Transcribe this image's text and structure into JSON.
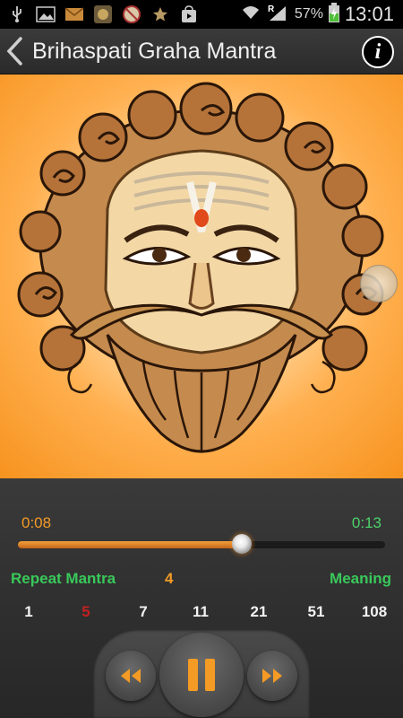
{
  "status_bar": {
    "icons": [
      "usb-icon",
      "image-icon",
      "mail-icon",
      "app-icon",
      "blocked-icon",
      "star-icon",
      "store-icon"
    ],
    "wifi": "wifi-icon",
    "signal_label": "R",
    "battery": "57%",
    "time": "13:01"
  },
  "action_bar": {
    "title": "Brihaspati Graha Mantra",
    "info_label": "i"
  },
  "player": {
    "current_time": "0:08",
    "total_time": "0:13",
    "progress": 0.61,
    "repeat_label": "Repeat Mantra",
    "repeat_count": "4",
    "meaning_label": "Meaning",
    "repeat_options": [
      "1",
      "5",
      "7",
      "11",
      "21",
      "51",
      "108"
    ],
    "selected_option": "5"
  },
  "colors": {
    "accent_orange": "#f39b25",
    "accent_green": "#39c95a",
    "selected_red": "#c42020"
  }
}
